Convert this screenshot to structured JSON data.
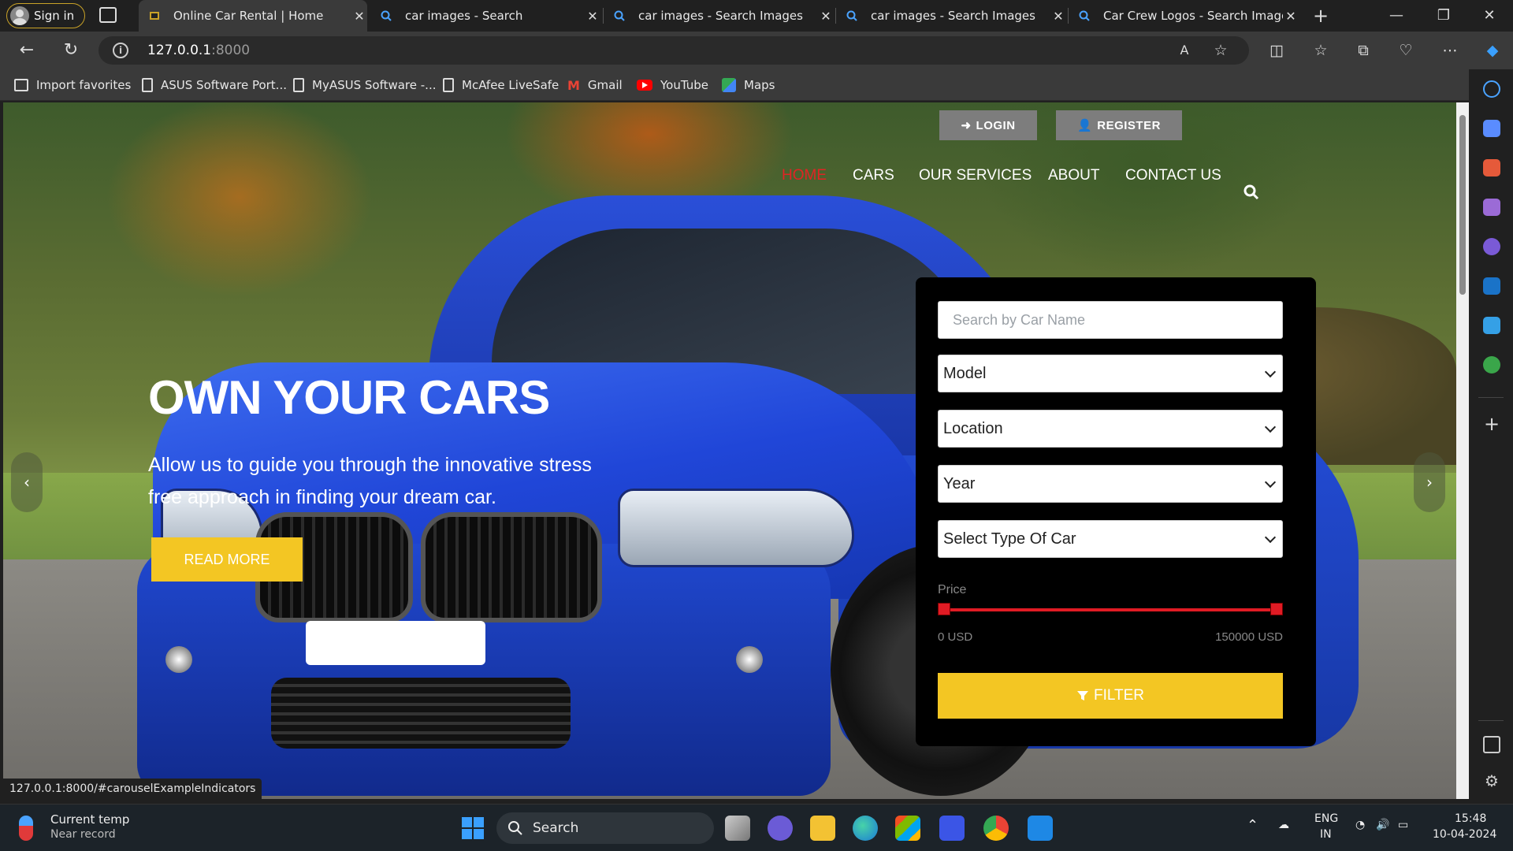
{
  "browser": {
    "signin_label": "Sign in",
    "tabs": [
      {
        "title": "Online Car Rental | Home",
        "active": true
      },
      {
        "title": "car images - Search"
      },
      {
        "title": "car images - Search Images"
      },
      {
        "title": "car images - Search Images"
      },
      {
        "title": "Car Crew Logos - Search Images"
      }
    ],
    "url_host": "127.0.0.1",
    "url_port": ":8000",
    "favorites": [
      {
        "label": "Import favorites",
        "icon": "import-icon"
      },
      {
        "label": "ASUS Software Port...",
        "icon": "page-icon"
      },
      {
        "label": "MyASUS Software -...",
        "icon": "page-icon"
      },
      {
        "label": "McAfee LiveSafe",
        "icon": "page-icon"
      },
      {
        "label": "Gmail",
        "icon": "gmail-icon"
      },
      {
        "label": "YouTube",
        "icon": "youtube-icon"
      },
      {
        "label": "Maps",
        "icon": "maps-icon"
      }
    ],
    "status_url": "127.0.0.1:8000/#carouselExampleIndicators"
  },
  "site": {
    "login_label": "LOGIN",
    "register_label": "REGISTER",
    "nav": [
      "HOME",
      "CARS",
      "OUR SERVICES",
      "ABOUT",
      "CONTACT US"
    ],
    "hero_title": "OWN YOUR CARS",
    "hero_subtitle": "Allow us to guide you through the innovative stress free approach in finding your dream car.",
    "read_more": "READ MORE",
    "accent_color": "#f3c623",
    "active_nav_color": "#e02424"
  },
  "filter": {
    "search_placeholder": "Search by Car Name",
    "model": "Model",
    "location": "Location",
    "year": "Year",
    "type": "Select Type Of Car",
    "price_label": "Price",
    "price_min": "0 USD",
    "price_max": "150000 USD",
    "filter_button": "FILTER"
  },
  "taskbar": {
    "weather_title": "Current temp",
    "weather_sub": "Near record",
    "search_label": "Search",
    "lang_top": "ENG",
    "lang_bottom": "IN",
    "time": "15:48",
    "date": "10-04-2024"
  }
}
